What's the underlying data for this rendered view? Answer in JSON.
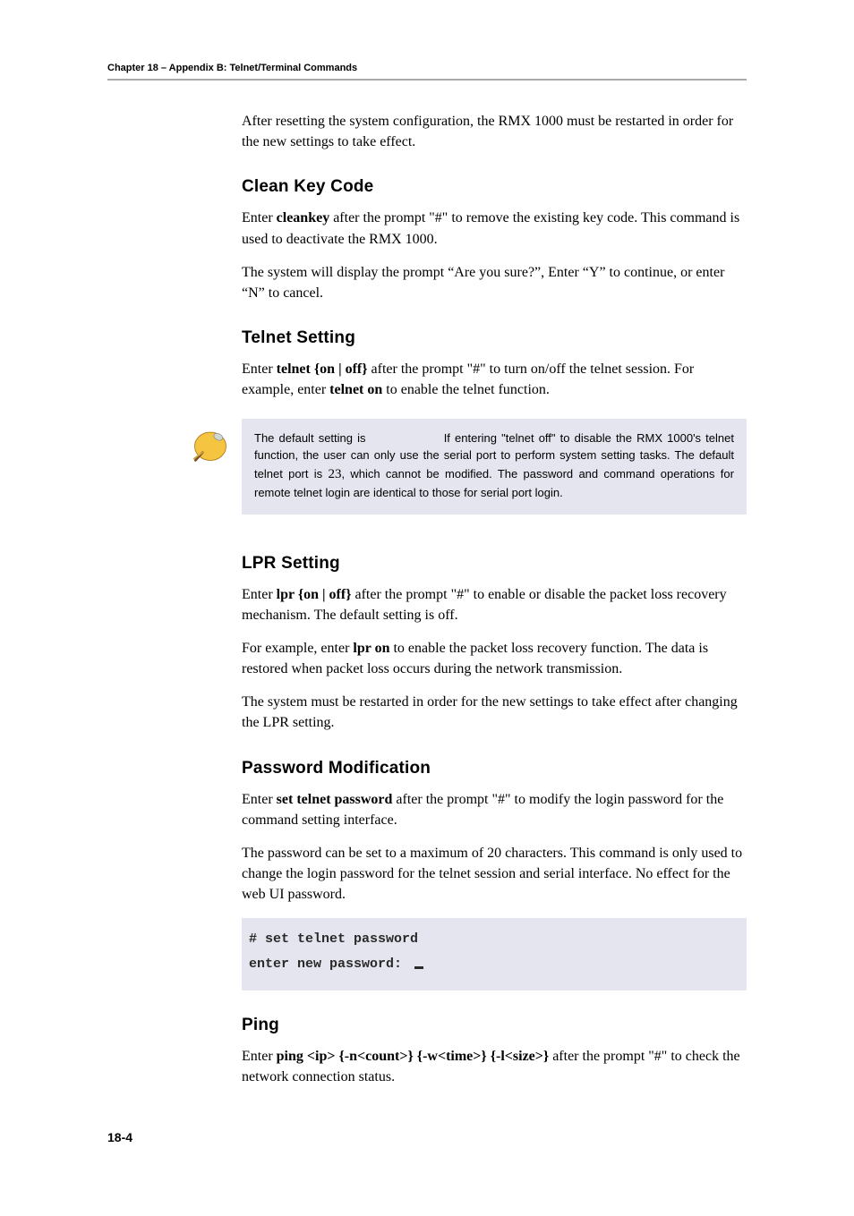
{
  "header": {
    "running_head": "Chapter 18 – Appendix B: Telnet/Terminal Commands"
  },
  "intro": {
    "p1": "After resetting the system configuration, the RMX 1000 must be restarted in order for the new settings to take effect."
  },
  "clean_key": {
    "heading": "Clean Key Code",
    "p1_a": "Enter ",
    "p1_cmd": "cleankey",
    "p1_b": " after the prompt \"#\" to remove the existing key code. This command is used to deactivate the RMX 1000.",
    "p2": "The system will display the prompt “Are you sure?”, Enter “Y” to continue, or enter “N” to cancel."
  },
  "telnet": {
    "heading": "Telnet Setting",
    "p1_a": "Enter ",
    "p1_cmd": "telnet {on | off}",
    "p1_b": " after the prompt \"#\" to turn on/off the telnet session. For example, enter ",
    "p1_cmd2": "telnet on",
    "p1_c": " to enable the telnet function.",
    "note_a": "The default setting is",
    "note_b": "If entering \"telnet off\" to disable the RMX 1000's telnet function, the user can only use the serial port to perform system setting tasks. The default telnet port is ",
    "note_port": "23",
    "note_c": ", which cannot be modified. The password and command operations for remote telnet login are identical to those for serial port login."
  },
  "lpr": {
    "heading": "LPR Setting",
    "p1_a": "Enter ",
    "p1_cmd": "lpr {on | off}",
    "p1_b": " after the prompt \"#\" to enable or disable the packet loss recovery mechanism. The default setting is off.",
    "p2_a": "For example, enter ",
    "p2_cmd": "lpr on",
    "p2_b": " to enable the packet loss recovery function. The data is restored when packet loss occurs during the network transmission.",
    "p3": "The system must be restarted in order for the new settings to take effect after changing the LPR setting."
  },
  "password": {
    "heading": "Password Modification",
    "p1_a": "Enter ",
    "p1_cmd": "set telnet password",
    "p1_b": " after the prompt \"#\" to modify the login password for the command setting interface.",
    "p2": "The password can be set to a maximum of 20 characters. This command is only used to change the login password for the telnet session and serial interface. No effect for the web UI password.",
    "term_line1": "# set telnet password",
    "term_line2": "enter new password:"
  },
  "ping": {
    "heading": "Ping",
    "p1_a": "Enter ",
    "p1_cmd": "ping <ip> {-n<count>} {-w<time>} {-l<size>}",
    "p1_b": " after the prompt \"#\" to check the network connection status."
  },
  "footer": {
    "page_num": "18-4"
  }
}
